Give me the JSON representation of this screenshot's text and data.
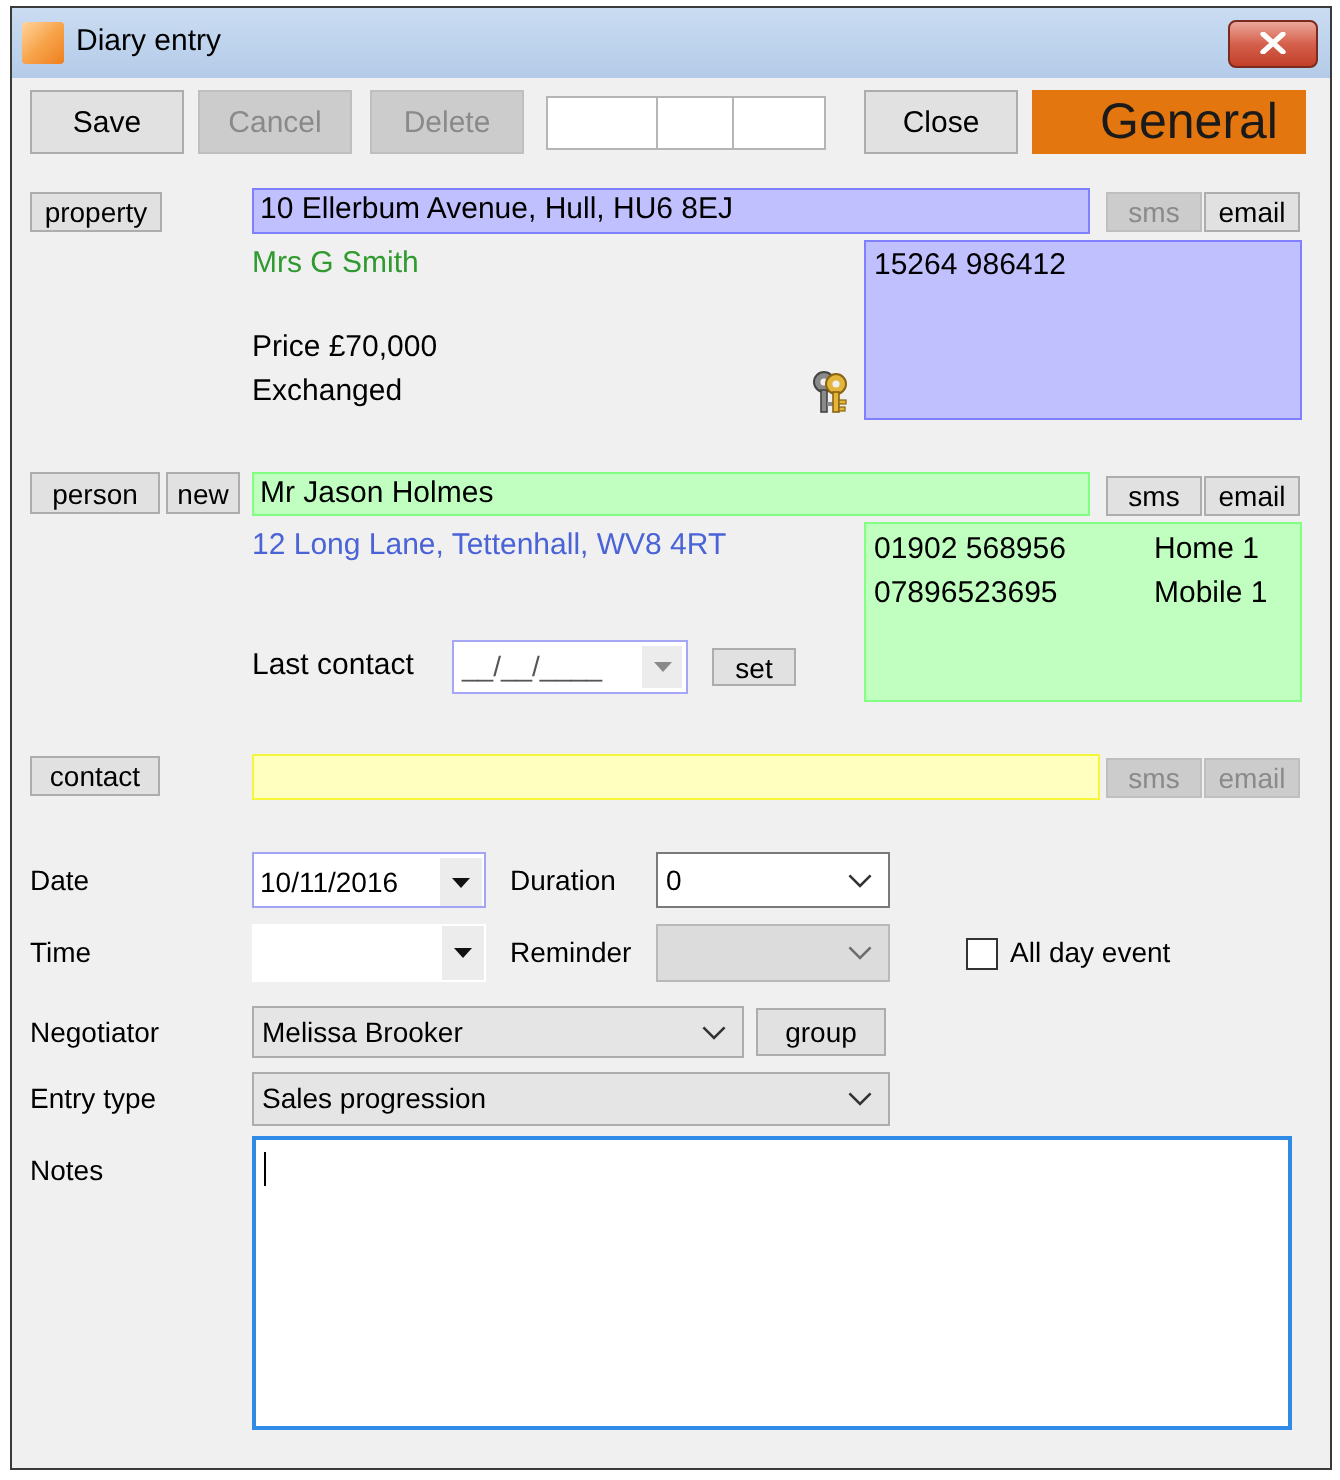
{
  "window": {
    "title": "Diary entry"
  },
  "toolbar": {
    "buttons": [
      {
        "label": "Save",
        "disabled": false
      },
      {
        "label": "Cancel",
        "disabled": true
      },
      {
        "label": "Delete",
        "disabled": true
      }
    ],
    "close": {
      "label": "Close",
      "disabled": false
    },
    "category": "General"
  },
  "property": {
    "button": "property",
    "address": "10 Ellerbum Avenue, Hull, HU6 8EJ",
    "sms": {
      "label": "sms",
      "disabled": true
    },
    "email": {
      "label": "email",
      "disabled": false
    },
    "owner": "Mrs G Smith",
    "details": [
      "Price £70,000",
      "Exchanged"
    ],
    "phones": [
      {
        "number": "15264 986412"
      }
    ]
  },
  "person": {
    "buttons": [
      "person",
      "new"
    ],
    "name": "Mr Jason Holmes",
    "sms": {
      "label": "sms",
      "disabled": false
    },
    "email": {
      "label": "email",
      "disabled": false
    },
    "address": "12 Long Lane, Tettenhall, WV8 4RT",
    "last_contact": {
      "label": "Last contact",
      "value": "__/__/____"
    },
    "set_button": "set",
    "phones": [
      {
        "number": "01902 568956",
        "type": "Home 1"
      },
      {
        "number": "07896523695",
        "type": "Mobile 1"
      }
    ]
  },
  "contact": {
    "button": "contact",
    "sms": {
      "label": "sms",
      "disabled": true
    },
    "email": {
      "label": "email",
      "disabled": true
    }
  },
  "form": {
    "date": {
      "label": "Date",
      "value": "10/11/2016"
    },
    "duration": {
      "label": "Duration",
      "value": "0"
    },
    "time": {
      "label": "Time"
    },
    "reminder": {
      "label": "Reminder",
      "disabled": true
    },
    "all_day": {
      "label": "All day event",
      "checked": false
    },
    "negotiator": {
      "label": "Negotiator",
      "value": "Melissa Brooker"
    },
    "group_button": "group",
    "entry_type": {
      "label": "Entry type",
      "value": "Sales progression"
    },
    "notes": {
      "label": "Notes",
      "focused": true
    }
  }
}
